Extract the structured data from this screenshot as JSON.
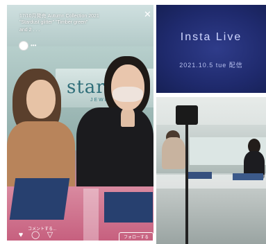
{
  "left_story": {
    "line1": "17/10月発売 Autumn Collection 2021",
    "line2": "\"Stardust glitter\" \"Timber green\"",
    "line3": "and 2 . . .",
    "brand_sign": "staria",
    "brand_sub": "JEWELRY",
    "comment_hint": "コメントする...",
    "button_label": "フォローする",
    "icons": [
      "heart-icon",
      "comment-icon",
      "send-icon"
    ]
  },
  "title_card": {
    "title": "Insta Live",
    "date": "2021.10.5 tue 配信"
  }
}
